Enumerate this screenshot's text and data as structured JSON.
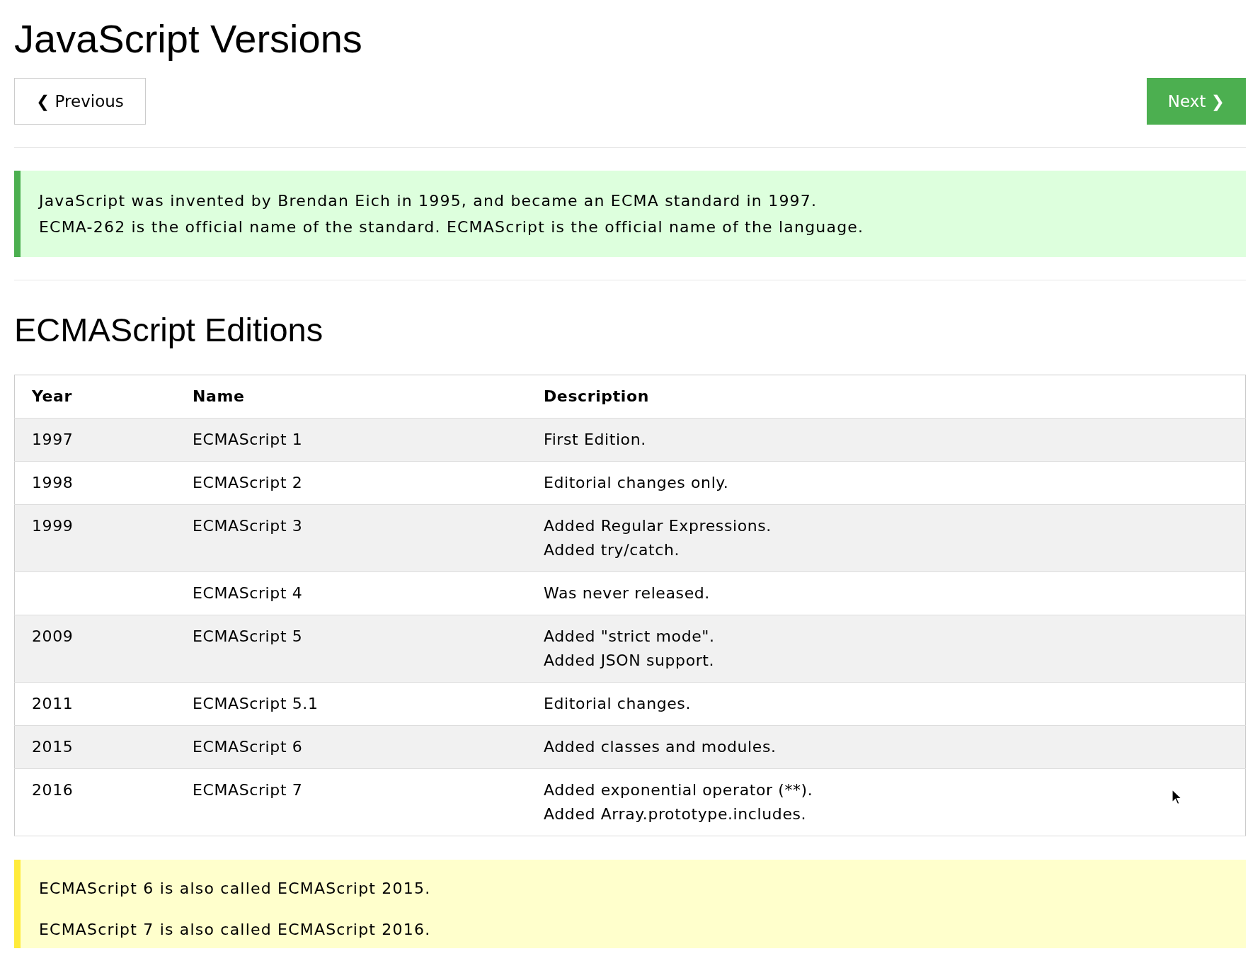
{
  "title": "JavaScript Versions",
  "nav": {
    "previous": {
      "icon": "❮",
      "label": "Previous"
    },
    "next": {
      "label": "Next",
      "icon": "❯"
    }
  },
  "intro_note": {
    "lines": [
      "JavaScript was invented by Brendan Eich in 1995, and became an ECMA standard in 1997.",
      "ECMA-262 is the official name of the standard. ECMAScript is the official name of the language."
    ]
  },
  "section_heading": "ECMAScript Editions",
  "table": {
    "columns": [
      "Year",
      "Name",
      "Description"
    ],
    "rows": [
      {
        "year": "1997",
        "name": "ECMAScript 1",
        "description": [
          "First Edition."
        ]
      },
      {
        "year": "1998",
        "name": "ECMAScript 2",
        "description": [
          "Editorial changes only."
        ]
      },
      {
        "year": "1999",
        "name": "ECMAScript 3",
        "description": [
          "Added Regular Expressions.",
          "Added try/catch."
        ]
      },
      {
        "name": "ECMAScript 4",
        "description": [
          "Was never released."
        ]
      },
      {
        "year": "2009",
        "name": "ECMAScript 5",
        "description": [
          "Added \"strict mode\".",
          "Added JSON support."
        ]
      },
      {
        "year": "2011",
        "name": "ECMAScript 5.1",
        "description": [
          "Editorial changes."
        ]
      },
      {
        "year": "2015",
        "name": "ECMAScript 6",
        "description": [
          "Added classes and modules."
        ]
      },
      {
        "year": "2016",
        "name": "ECMAScript 7",
        "description": [
          "Added exponential operator (**).",
          "Added Array.prototype.includes."
        ]
      }
    ]
  },
  "footer_note": {
    "paragraphs": [
      "ECMAScript 6 is also called ECMAScript 2015.",
      "ECMAScript 7 is also called ECMAScript 2016."
    ]
  }
}
